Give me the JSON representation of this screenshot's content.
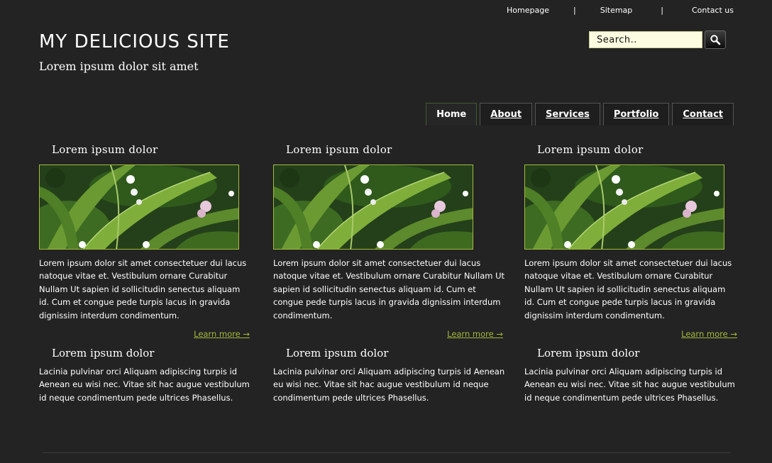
{
  "top_links": [
    "Homepage",
    "Sitemap",
    "Contact us"
  ],
  "separator": "|",
  "site": {
    "title": "MY DELICIOUS SITE",
    "tagline": "Lorem ipsum dolor sit amet"
  },
  "search": {
    "placeholder": "Search..",
    "button_icon": "magnifier-icon"
  },
  "nav": {
    "tabs": [
      "Home",
      "About",
      "Services",
      "Portfolio",
      "Contact"
    ],
    "active": "Home"
  },
  "columns": [
    {
      "heading": "Lorem ipsum dolor",
      "image": "green-leaves-photo",
      "text": "Lorem ipsum dolor sit amet consectetuer dui lacus natoque vitae et. Vestibulum ornare Curabitur Nullam Ut sapien id sollicitudin senectus aliquam id. Cum et congue pede turpis lacus in gravida dignissim interdum condimentum.",
      "link": "Learn more →"
    },
    {
      "heading": "Lorem ipsum dolor",
      "image": "green-leaves-photo",
      "text": "Lorem ipsum dolor sit amet consectetuer dui lacus natoque vitae et. Vestibulum ornare Curabitur Nullam Ut sapien id sollicitudin senectus aliquam id. Cum et congue pede turpis lacus in gravida dignissim interdum condimentum.",
      "link": "Learn more →"
    },
    {
      "heading": "Lorem ipsum dolor",
      "image": "green-leaves-photo",
      "text": "Lorem ipsum dolor sit amet consectetuer dui lacus natoque vitae et. Vestibulum ornare Curabitur Nullam Ut sapien id sollicitudin senectus aliquam id. Cum et congue pede turpis lacus in gravida dignissim interdum condimentum.",
      "link": "Learn more →"
    }
  ],
  "row2": [
    {
      "heading": "Lorem ipsum dolor",
      "text": "Lacinia pulvinar orci Aliquam adipiscing turpis id Aenean eu wisi nec. Vitae sit hac augue vestibulum id neque condimentum pede ultrices Phasellus."
    },
    {
      "heading": "Lorem ipsum dolor",
      "text": "Lacinia pulvinar orci Aliquam adipiscing turpis id Aenean eu wisi nec. Vitae sit hac augue vestibulum id neque condimentum pede ultrices Phasellus."
    },
    {
      "heading": "Lorem ipsum dolor",
      "text": "Lacinia pulvinar orci Aliquam adipiscing turpis id Aenean eu wisi nec. Vitae sit hac augue vestibulum id neque condimentum pede ultrices Phasellus."
    }
  ],
  "colors": {
    "background": "#232323",
    "accent_link": "#a3b83c",
    "image_border": "#a3bc3c",
    "search_bg": "#fcfde0"
  }
}
